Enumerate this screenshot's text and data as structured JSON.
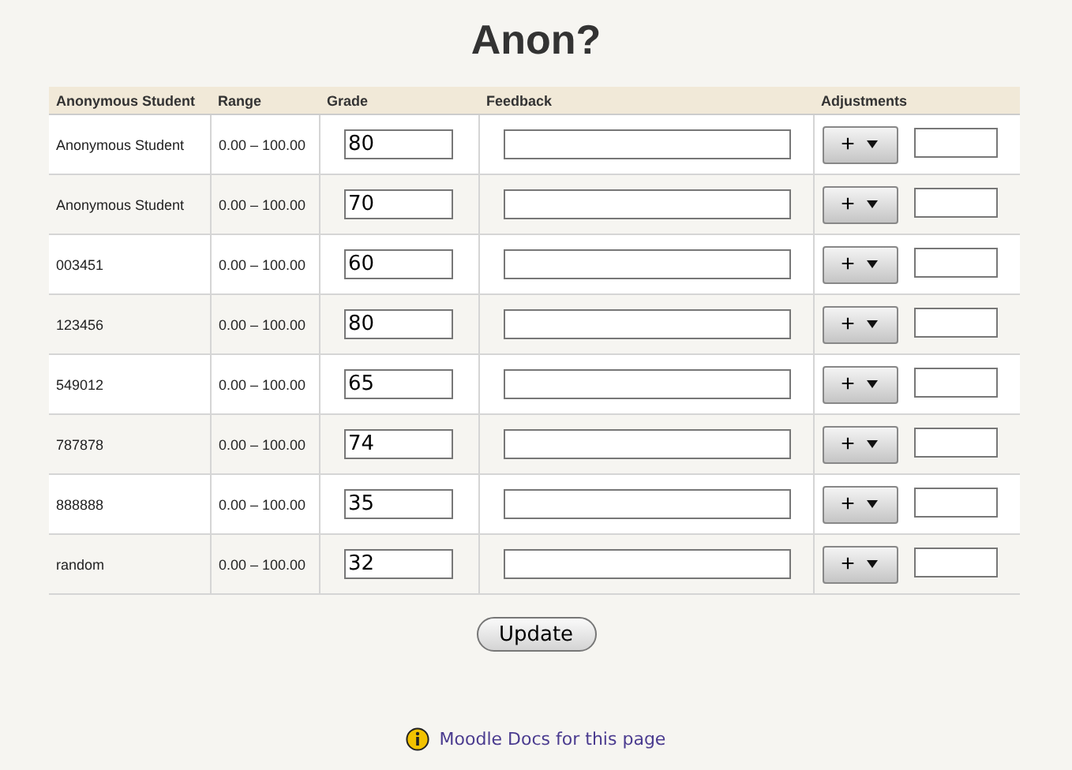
{
  "title": "Anon?",
  "table": {
    "columns": [
      "Anonymous Student",
      "Range",
      "Grade",
      "Feedback",
      "Adjustments"
    ],
    "rows": [
      {
        "student": "Anonymous Student",
        "range": "0.00 – 100.00",
        "grade": "80",
        "adjust_button": "+"
      },
      {
        "student": "Anonymous Student",
        "range": "0.00 – 100.00",
        "grade": "70",
        "adjust_button": "+"
      },
      {
        "student": "003451",
        "range": "0.00 – 100.00",
        "grade": "60",
        "adjust_button": "+"
      },
      {
        "student": "123456",
        "range": "0.00 – 100.00",
        "grade": "80",
        "adjust_button": "+"
      },
      {
        "student": "549012",
        "range": "0.00 – 100.00",
        "grade": "65",
        "adjust_button": "+"
      },
      {
        "student": "787878",
        "range": "0.00 – 100.00",
        "grade": "74",
        "adjust_button": "+"
      },
      {
        "student": "888888",
        "range": "0.00 – 100.00",
        "grade": "35",
        "adjust_button": "+"
      },
      {
        "student": "random",
        "range": "0.00 – 100.00",
        "grade": "32",
        "adjust_button": "+"
      }
    ]
  },
  "update_button": "Update",
  "docs_link": "Moodle Docs for this page"
}
